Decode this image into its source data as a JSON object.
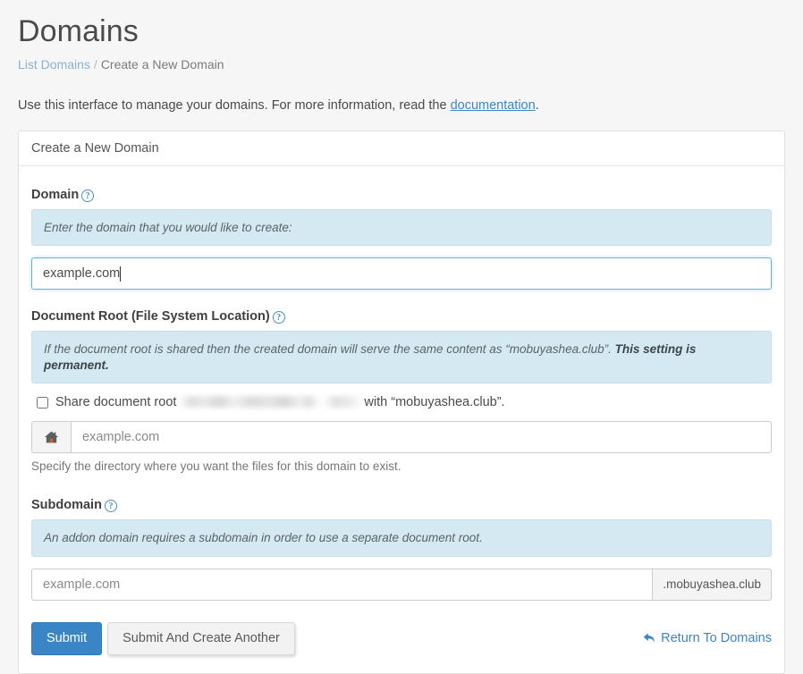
{
  "header": {
    "title": "Domains",
    "breadcrumb": {
      "parent": "List Domains",
      "separator": "/",
      "current": "Create a New Domain"
    },
    "intro_prefix": "Use this interface to manage your domains. For more information, read the ",
    "intro_link": "documentation",
    "intro_suffix": "."
  },
  "panel": {
    "heading": "Create a New Domain",
    "domain_section": {
      "label": "Domain",
      "help_icon": "question-circle-icon",
      "info_text": "Enter the domain that you would like to create:",
      "input_value": "example.com"
    },
    "document_root_section": {
      "label": "Document Root (File System Location)",
      "help_icon": "question-circle-icon",
      "info_text_prefix": "If the document root is shared then the created domain will serve the same content as “mobuyashea.club”. ",
      "info_text_emphasis": "This setting is permanent.",
      "share_checkbox_prefix": "Share document root",
      "share_checkbox_suffix": "with “mobuyashea.club”.",
      "share_checkbox_checked": "false",
      "addon_icon": "home-icon",
      "input_placeholder": "example.com",
      "help_block": "Specify the directory where you want the files for this domain to exist."
    },
    "subdomain_section": {
      "label": "Subdomain",
      "help_icon": "question-circle-icon",
      "info_text": "An addon domain requires a subdomain in order to use a separate document root.",
      "input_placeholder": "example.com",
      "suffix_addon": ".mobuyashea.club"
    },
    "actions": {
      "submit_label": "Submit",
      "submit_another_label": "Submit And Create Another",
      "return_link_label": "Return To Domains",
      "return_link_icon": "reply-arrow-icon"
    }
  },
  "colors": {
    "primary": "#3a85c6",
    "link": "#3a86c8",
    "info_bg": "#d4e9f2",
    "page_bg": "#f6f6f6",
    "focus_border": "#66afe9"
  }
}
